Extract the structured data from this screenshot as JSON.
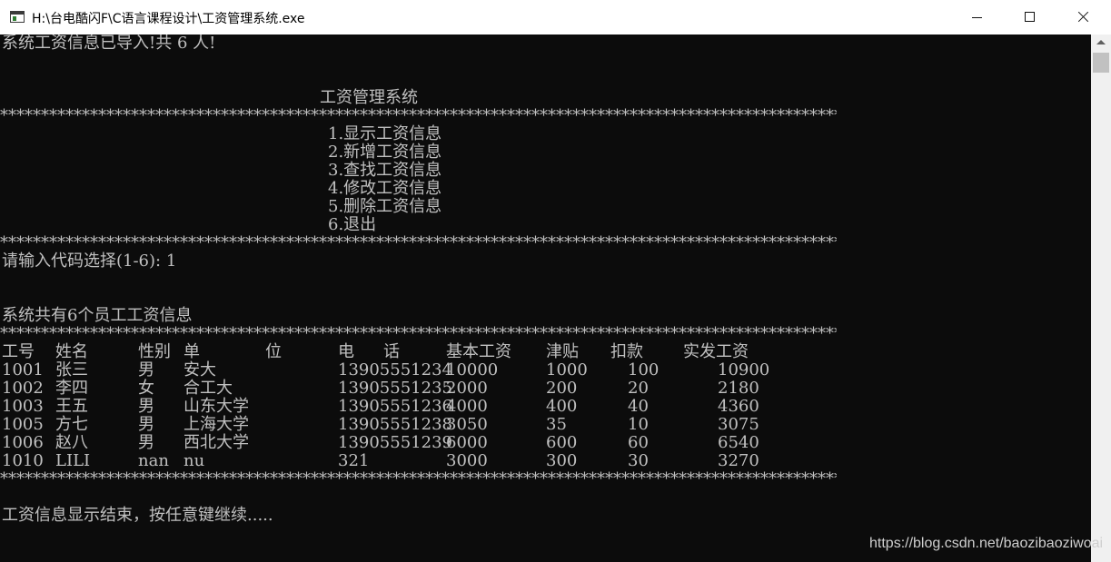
{
  "window": {
    "title": "H:\\台电酷闪F\\C语言课程设计\\工资管理系统.exe"
  },
  "console": {
    "import_msg": "系统工资信息已导入!共 6 人!",
    "menu_title": "工资管理系统",
    "stars": "***************************************************************************************************************",
    "menu": [
      "1.显示工资信息",
      "2.新增工资信息",
      "3.查找工资信息",
      "4.修改工资信息",
      "5.删除工资信息",
      "6.退出"
    ],
    "prompt": "请输入代码选择(1-6): 1",
    "count_msg": "系统共有6个员工工资信息",
    "headers": [
      "工号",
      "姓名",
      "性别",
      "单",
      "位",
      "电",
      "话",
      "基本工资",
      "津贴",
      "扣款",
      "实发工资"
    ],
    "rows": [
      [
        "1001",
        "张三",
        "男",
        "安大",
        "13905551234",
        "10000",
        "1000",
        "100",
        "10900"
      ],
      [
        "1002",
        "李四",
        "女",
        "合工大",
        "13905551235",
        "2000",
        "200",
        "20",
        "2180"
      ],
      [
        "1003",
        "王五",
        "男",
        "山东大学",
        "13905551236",
        "4000",
        "400",
        "40",
        "4360"
      ],
      [
        "1005",
        "方七",
        "男",
        "上海大学",
        "13905551238",
        "3050",
        "35",
        "10",
        "3075"
      ],
      [
        "1006",
        "赵八",
        "男",
        "西北大学",
        "13905551239",
        "6000",
        "600",
        "60",
        "6540"
      ],
      [
        "1010",
        "LILI",
        "nan",
        "nu",
        "321",
        "3000",
        "300",
        "30",
        "3270"
      ]
    ],
    "end_msg": "工资信息显示结束，按任意键继续....."
  },
  "watermark": "https://blog.csdn.net/baozibaoziwoai"
}
